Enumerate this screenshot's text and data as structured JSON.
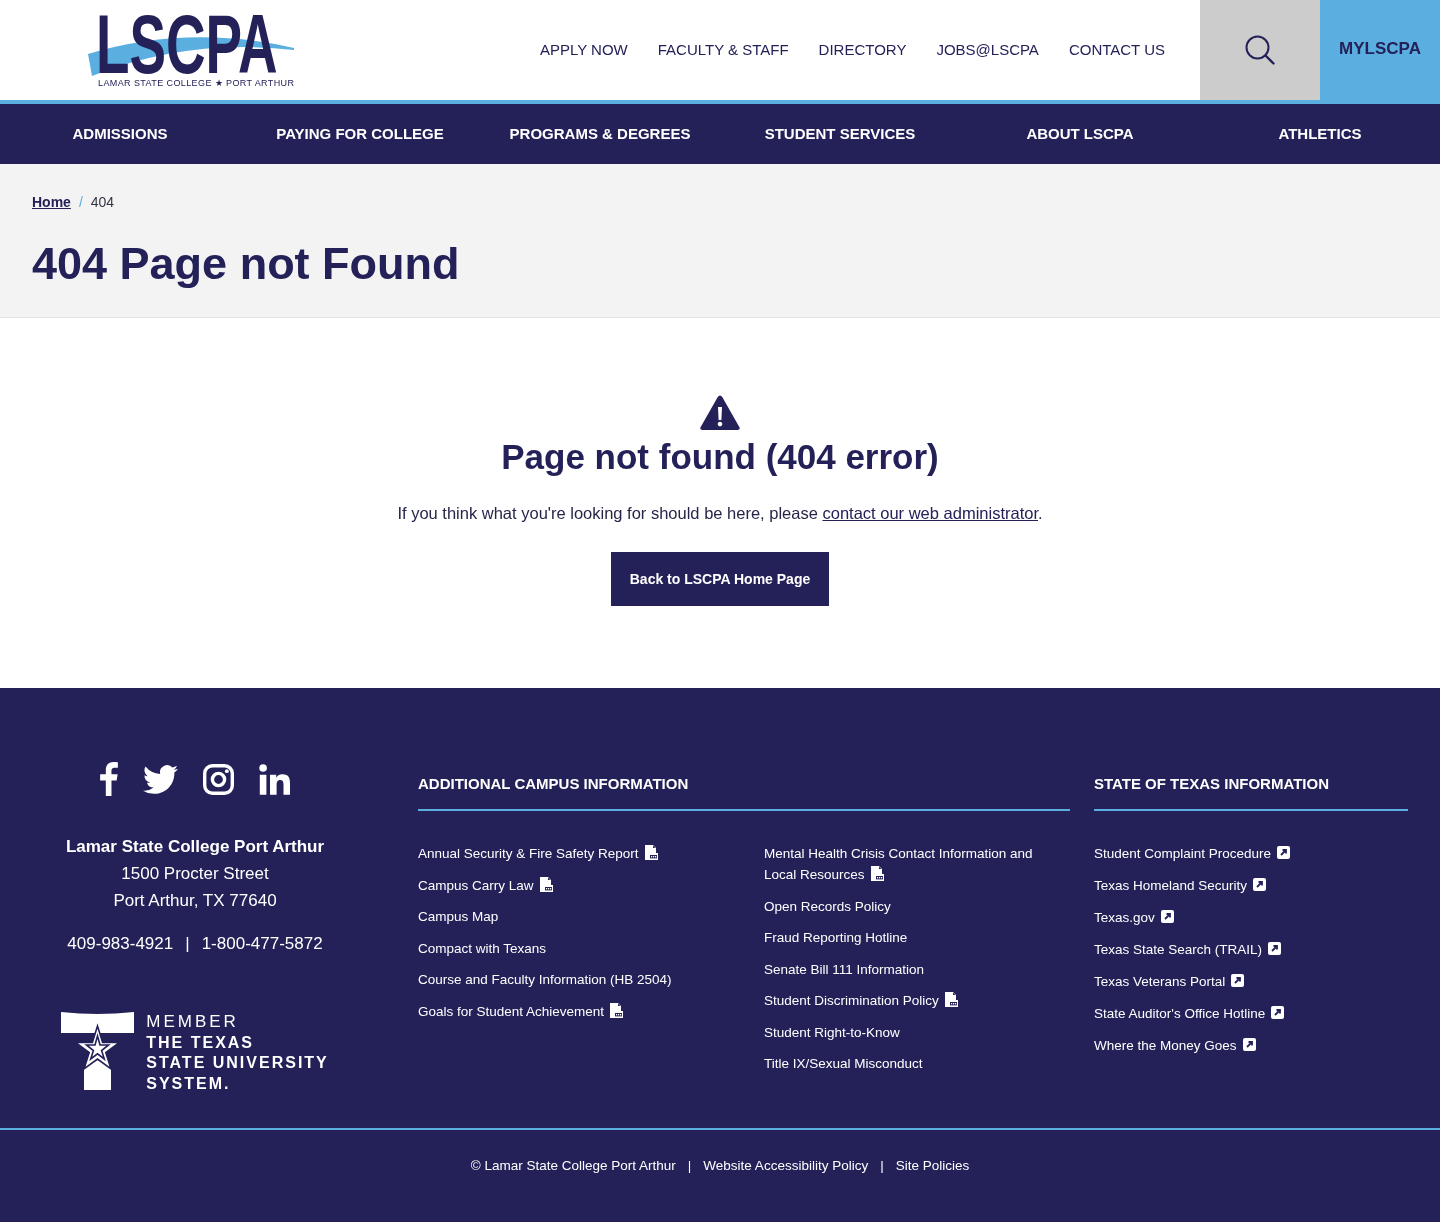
{
  "header": {
    "logo": {
      "wordmark": "LSCPA",
      "tagline": "LAMAR STATE COLLEGE ★ PORT ARTHUR"
    },
    "utility_links": [
      "APPLY NOW",
      "FACULTY & STAFF",
      "DIRECTORY",
      "JOBS@LSCPA",
      "CONTACT US"
    ],
    "portal_button": "MYLSCPA"
  },
  "main_nav": [
    "ADMISSIONS",
    "PAYING FOR COLLEGE",
    "PROGRAMS & DEGREES",
    "STUDENT SERVICES",
    "ABOUT LSCPA",
    "ATHLETICS"
  ],
  "breadcrumb": {
    "separator": "/",
    "items": [
      {
        "label": "Home",
        "current": false
      },
      {
        "label": "404",
        "current": true
      }
    ]
  },
  "page_title": "404 Page not Found",
  "error": {
    "heading": "Page not found (404 error)",
    "message": "If you think what you're looking for should be here, please ",
    "link": "contact our web administrator",
    "message_end": ".",
    "button": "Back to LSCPA Home Page"
  },
  "footer": {
    "address": {
      "name": "Lamar State College Port Arthur",
      "lines": [
        "1500 Procter Street",
        "Port Arthur, TX 77640"
      ]
    },
    "phones": {
      "numbers": [
        "409-983-4921",
        "1-800-477-5872"
      ],
      "separators": [
        "|"
      ]
    },
    "member_badge": {
      "caption": "MEMBER",
      "name_lines": [
        "THE TEXAS",
        "STATE UNIVERSITY",
        "SYSTEM."
      ]
    },
    "campus_info": {
      "heading": "ADDITIONAL CAMPUS INFORMATION",
      "columns": [
        [
          {
            "label": "Annual Security & Fire Safety Report",
            "kind": "pdf"
          },
          {
            "label": "Campus Carry Law",
            "kind": "pdf"
          },
          {
            "label": "Campus Map",
            "kind": "page"
          },
          {
            "label": "Compact with Texans",
            "kind": "page"
          },
          {
            "label": "Course and Faculty Information (HB 2504)",
            "kind": "page"
          },
          {
            "label": "Goals for Student Achievement",
            "kind": "pdf"
          }
        ],
        [
          {
            "label": "Mental Health Crisis Contact Information and Local Resources",
            "kind": "pdf"
          },
          {
            "label": "Open Records Policy",
            "kind": "page"
          },
          {
            "label": "Fraud Reporting Hotline",
            "kind": "page"
          },
          {
            "label": "Senate Bill 111 Information",
            "kind": "page"
          },
          {
            "label": "Student Discrimination Policy",
            "kind": "pdf"
          },
          {
            "label": "Student Right-to-Know",
            "kind": "page"
          },
          {
            "label": "Title IX/Sexual Misconduct",
            "kind": "page"
          }
        ]
      ]
    },
    "state_info": {
      "heading": "STATE OF TEXAS INFORMATION",
      "links": [
        {
          "label": "Student Complaint Procedure",
          "kind": "external"
        },
        {
          "label": "Texas Homeland Security",
          "kind": "external"
        },
        {
          "label": "Texas.gov",
          "kind": "external"
        },
        {
          "label": "Texas State Search (TRAIL)",
          "kind": "external"
        },
        {
          "label": "Texas Veterans Portal",
          "kind": "external"
        },
        {
          "label": "State Auditor's Office Hotline",
          "kind": "external"
        },
        {
          "label": "Where the Money Goes",
          "kind": "external"
        }
      ]
    }
  },
  "legal_bar": {
    "items": [
      "© Lamar State College Port Arthur",
      "Website Accessibility Policy",
      "Site Policies"
    ],
    "separators": [
      "|",
      "|"
    ]
  }
}
